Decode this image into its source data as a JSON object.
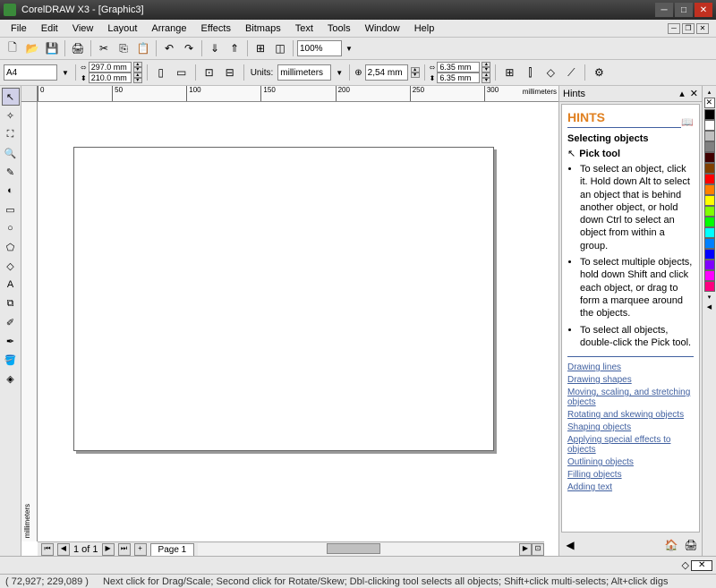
{
  "titlebar": {
    "text": "CorelDRAW X3 - [Graphic3]"
  },
  "menu": [
    "File",
    "Edit",
    "View",
    "Layout",
    "Arrange",
    "Effects",
    "Bitmaps",
    "Text",
    "Tools",
    "Window",
    "Help"
  ],
  "toolbar": {
    "zoom": "100%"
  },
  "propbar": {
    "paper": "A4",
    "width": "297.0 mm",
    "height": "210.0 mm",
    "units_label": "Units:",
    "units": "millimeters",
    "nudge": "2,54 mm",
    "dup_x": "6.35 mm",
    "dup_y": "6.35 mm"
  },
  "ruler": {
    "h_marks": [
      "0",
      "50",
      "100",
      "150",
      "200",
      "250",
      "300"
    ],
    "h_unit": "millimeters",
    "v_unit": "millimeters"
  },
  "pagenav": {
    "info": "1 of 1",
    "tab": "Page 1"
  },
  "hints": {
    "panel_title": "Hints",
    "title": "HINTS",
    "subtitle": "Selecting objects",
    "pick_tool": "Pick tool",
    "tips": [
      "To select an object, click it. Hold down Alt to select an object that is behind another object, or hold down Ctrl to select an object from within a group.",
      "To select multiple objects, hold down Shift and click each object, or drag to form a marquee around the objects.",
      "To select all objects, double-click the Pick tool."
    ],
    "links": [
      "Drawing lines",
      "Drawing shapes",
      "Moving, scaling, and stretching objects",
      "Rotating and skewing objects",
      "Shaping objects",
      "Applying special effects to objects",
      "Outlining objects",
      "Filling objects",
      "Adding text"
    ]
  },
  "palette": [
    "#000000",
    "#ffffff",
    "#c0c0c0",
    "#808080",
    "#400000",
    "#804000",
    "#ff0000",
    "#ff8000",
    "#ffff00",
    "#80ff00",
    "#00ff00",
    "#00ffff",
    "#0080ff",
    "#0000ff",
    "#8000ff",
    "#ff00ff",
    "#ff0080"
  ],
  "status": {
    "coords": "( 72,927; 229,089 )",
    "hint": "Next click for Drag/Scale; Second click for Rotate/Skew; Dbl-clicking tool selects all objects; Shift+click multi-selects; Alt+click digs"
  }
}
